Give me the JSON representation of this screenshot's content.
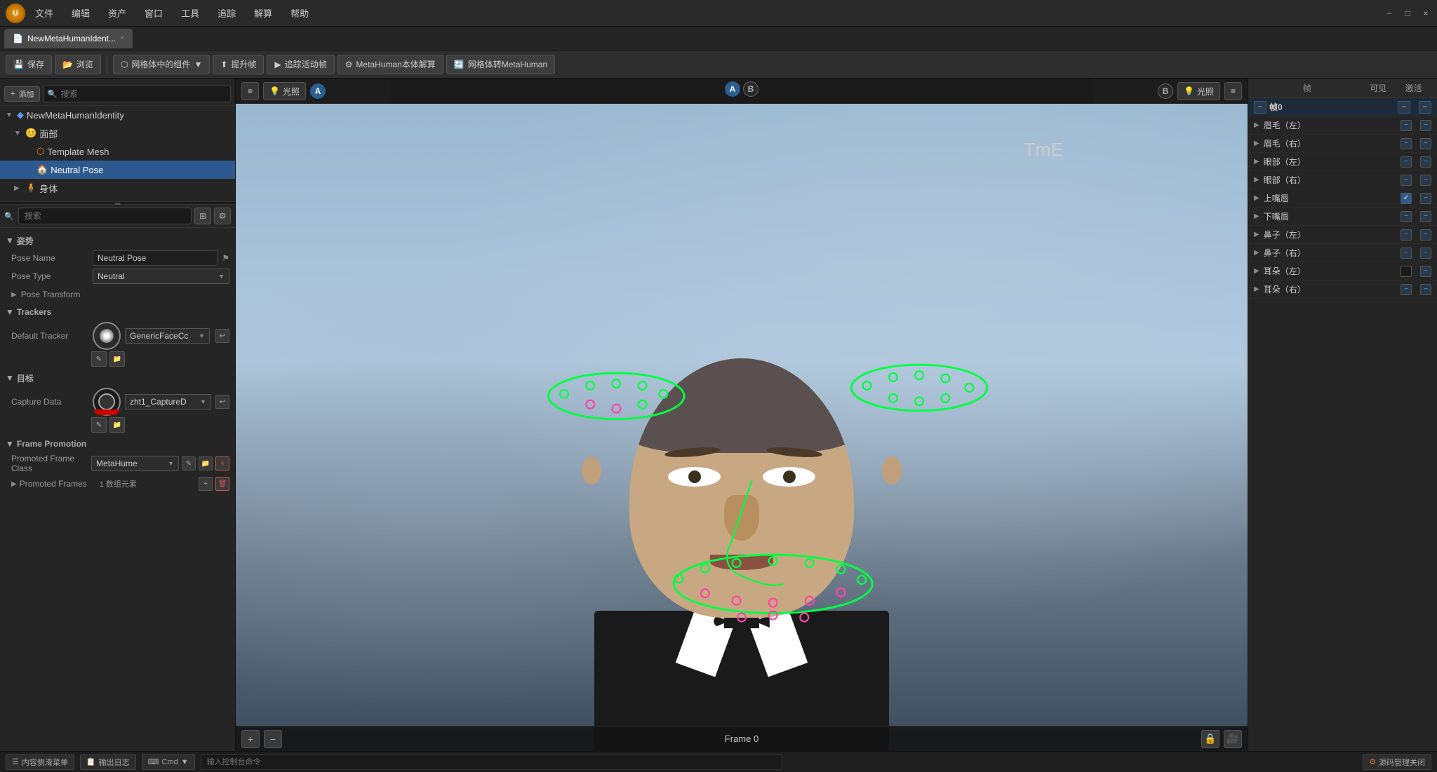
{
  "window": {
    "title": "NewMetaHumanIdent...",
    "close_label": "×",
    "min_label": "−",
    "max_label": "□"
  },
  "menu": {
    "items": [
      "文件",
      "编辑",
      "资产",
      "窗口",
      "工具",
      "追踪",
      "解算",
      "帮助"
    ]
  },
  "toolbar": {
    "save": "保存",
    "browse": "浏览",
    "mesh_in_grid": "网格体中的组件",
    "promote": "提升帧",
    "track_activity": "追踪活动帧",
    "metahuman_calc": "MetaHuman本体解算",
    "mesh_to_meta": "网格体转MetaHuman"
  },
  "left_panel": {
    "tree": {
      "root": "NewMetaHumanIdentity",
      "face": "面部",
      "template_mesh": "Template Mesh",
      "neutral_pose": "Neutral Pose",
      "body": "身体"
    },
    "search_placeholder": "搜索",
    "sections": {
      "pose": {
        "label": "姿势",
        "pose_name_label": "Pose Name",
        "pose_name_value": "Neutral Pose",
        "pose_type_label": "Pose Type",
        "pose_type_value": "Neutral",
        "pose_transform_label": "Pose Transform"
      },
      "trackers": {
        "label": "Trackers",
        "default_tracker_label": "Default Tracker",
        "default_tracker_value": "GenericFaceCc"
      },
      "targets": {
        "label": "目标",
        "capture_data_label": "Capture Data",
        "capture_data_value": "zht1_CaptureD"
      },
      "frame_promotion": {
        "label": "Frame Promotion",
        "promoted_frame_class_label": "Promoted Frame Class",
        "promoted_frame_class_value": "MetaHume",
        "promoted_frames_label": "Promoted Frames",
        "promoted_frames_value": "1 数组元素"
      }
    }
  },
  "viewport": {
    "left_toolbar": {
      "menu_icon": "≡",
      "light_label": "光照",
      "badge_a": "A"
    },
    "right_toolbar": {
      "badge_b": "B",
      "light_label": "光照",
      "menu_icon": "≡"
    },
    "ab_left": {
      "a": "A",
      "b": "B"
    },
    "ab_right": {
      "b": "B",
      "a": "A"
    },
    "frame_label": "Frame 0",
    "bottom_plus": "+",
    "bottom_minus": "−"
  },
  "right_panel": {
    "header": {
      "frame_col": "帧",
      "visible_col": "可见",
      "active_col": "激活"
    },
    "frame0_label": "帧0",
    "items": [
      {
        "label": "眉毛（左）",
        "visible": "dash",
        "active": "dash"
      },
      {
        "label": "眉毛（右）",
        "visible": "dash",
        "active": "dash"
      },
      {
        "label": "眼部（左）",
        "visible": "dash",
        "active": "dash"
      },
      {
        "label": "眼部（右）",
        "visible": "dash",
        "active": "dash"
      },
      {
        "label": "上嘴唇",
        "visible": "checked",
        "active": "dash"
      },
      {
        "label": "下嘴唇",
        "visible": "dash",
        "active": "dash"
      },
      {
        "label": "鼻子（左）",
        "visible": "dash",
        "active": "dash"
      },
      {
        "label": "鼻子（右）",
        "visible": "dash",
        "active": "dash"
      },
      {
        "label": "耳朵（左）",
        "visible": "unchecked",
        "active": "dash"
      },
      {
        "label": "耳朵（右）",
        "visible": "dash",
        "active": "dash"
      }
    ]
  },
  "statusbar": {
    "content_slider": "内容侧滑菜单",
    "output_log": "输出日志",
    "cmd_label": "Cmd",
    "cmd_placeholder": "输入控制台命令",
    "source_control": "源码管理关闭"
  },
  "tracking": {
    "tme_label": "TmE"
  }
}
